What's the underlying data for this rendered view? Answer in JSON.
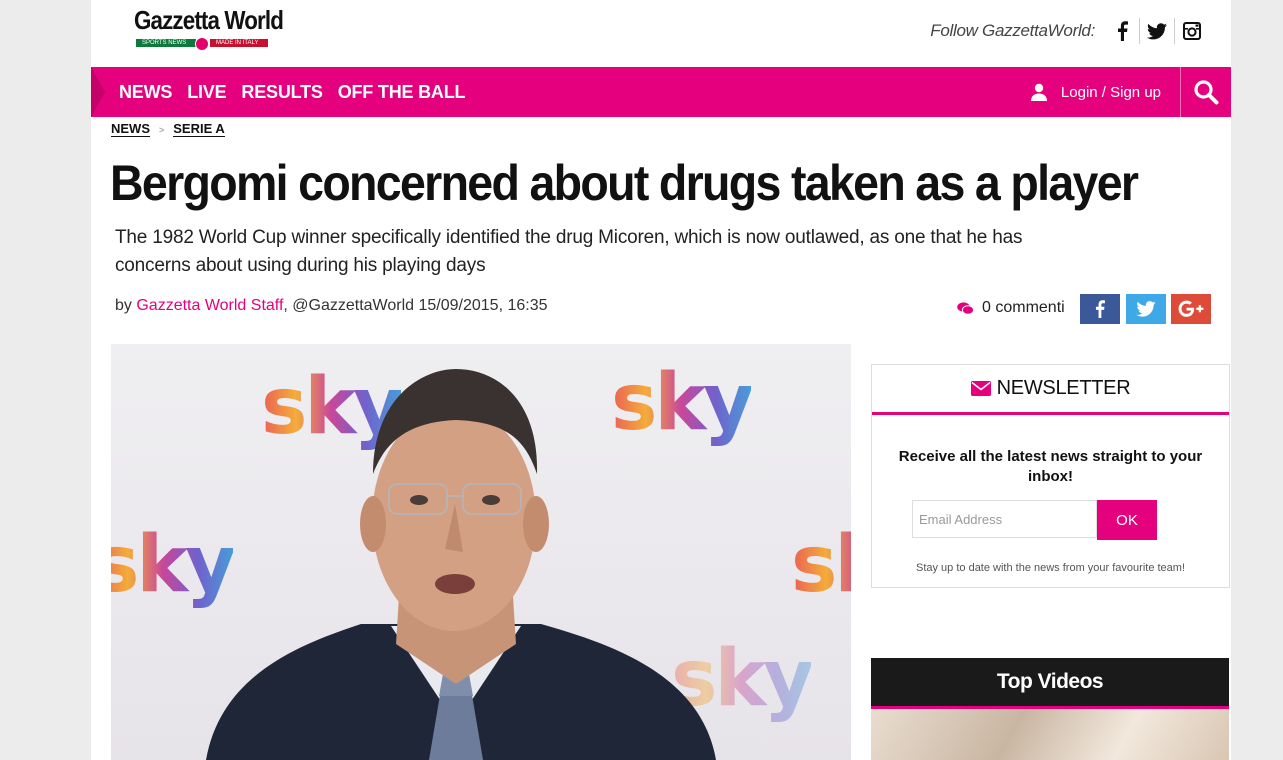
{
  "brand": {
    "logo": "Gazzetta World",
    "logo_tag_left": "SPORTS NEWS",
    "logo_tag_right": "MADE IN ITALY",
    "accent": "#e5007e"
  },
  "header": {
    "follow_label": "Follow GazzettaWorld:",
    "social_icons": [
      "facebook-icon",
      "twitter-icon",
      "instagram-icon"
    ]
  },
  "nav": {
    "items": [
      {
        "label": "NEWS"
      },
      {
        "label": "LIVE"
      },
      {
        "label": "RESULTS"
      },
      {
        "label": "OFF THE BALL"
      }
    ],
    "login_label": "Login / Sign up"
  },
  "breadcrumb": [
    "NEWS",
    "SERIE A"
  ],
  "article": {
    "title": "Bergomi concerned about drugs taken as a player",
    "subtitle": "The 1982 World Cup winner specifically identified the drug Micoren, which is now outlawed, as one that he has concerns about using during his playing days",
    "by": "by",
    "author": "Gazzetta World Staff",
    "handle_date": ", @GazzettaWorld 15/09/2015, 16:35",
    "comments": "0 commenti",
    "hero_logo_text": "sky"
  },
  "newsletter": {
    "heading": "NEWSLETTER",
    "text": "Receive all the latest news straight to your inbox!",
    "placeholder": "Email Address",
    "button": "OK",
    "note": "Stay up to date with the news from your favourite team!"
  },
  "top_videos": {
    "heading": "Top Videos"
  }
}
